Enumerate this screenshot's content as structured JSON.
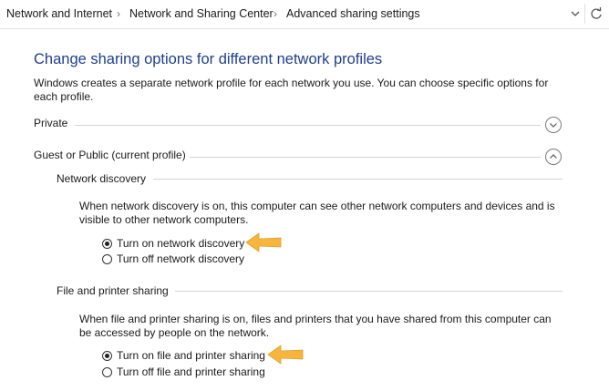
{
  "breadcrumb": {
    "items": [
      "Network and Internet",
      "Network and Sharing Center",
      "Advanced sharing settings"
    ],
    "separator": "›"
  },
  "icons": {
    "dropdown": "chevron-down-icon",
    "refresh": "refresh-icon",
    "expander_collapsed": "chevron-down-circle-icon",
    "expander_expanded": "chevron-up-circle-icon",
    "annotation": "arrow-annotation-icon"
  },
  "colors": {
    "title": "#1e3f8a",
    "rule": "#d3d3d3",
    "annotation_arrow": "#f6b53d"
  },
  "main": {
    "title": "Change sharing options for different network profiles",
    "description": "Windows creates a separate network profile for each network you use. You can choose specific options for each profile."
  },
  "profiles": {
    "private": {
      "label": "Private",
      "expanded": false
    },
    "guest_public": {
      "label": "Guest or Public (current profile)",
      "expanded": true
    }
  },
  "network_discovery": {
    "heading": "Network discovery",
    "description": "When network discovery is on, this computer can see other network computers and devices and is visible to other network computers.",
    "options": [
      {
        "label": "Turn on network discovery",
        "checked": true
      },
      {
        "label": "Turn off network discovery",
        "checked": false
      }
    ]
  },
  "file_printer_sharing": {
    "heading": "File and printer sharing",
    "description": "When file and printer sharing is on, files and printers that you have shared from this computer can be accessed by people on the network.",
    "options": [
      {
        "label": "Turn on file and printer sharing",
        "checked": true
      },
      {
        "label": "Turn off file and printer sharing",
        "checked": false
      }
    ]
  }
}
